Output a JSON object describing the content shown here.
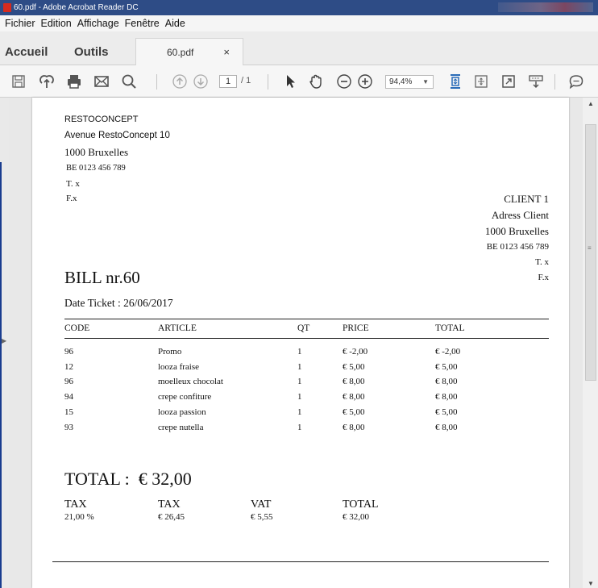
{
  "window": {
    "title": "60.pdf - Adobe Acrobat Reader DC"
  },
  "menu": [
    "Fichier",
    "Edition",
    "Affichage",
    "Fenêtre",
    "Aide"
  ],
  "tabs": {
    "home": "Accueil",
    "tools": "Outils",
    "doc": "60.pdf",
    "close": "×"
  },
  "toolbar": {
    "icons": [
      "save-icon",
      "upload-icon",
      "print-icon",
      "email-icon",
      "search-icon",
      "previous-page-icon",
      "next-page-icon",
      "select-tool-icon",
      "hand-tool-icon",
      "zoom-out-icon",
      "zoom-in-icon",
      "fit-page-icon",
      "full-screen-icon",
      "read-mode-icon",
      "keyboard-icon",
      "comment-icon"
    ],
    "page_current": "1",
    "page_total": "/ 1",
    "zoom": "94,4%"
  },
  "document": {
    "company": {
      "name": "RESTOCONCEPT",
      "address": "Avenue RestoConcept 10",
      "city": "1000 Bruxelles",
      "vat": "BE 0123 456 789",
      "tel": "T. x",
      "fax": "F.x"
    },
    "client": {
      "name": "CLIENT 1",
      "address": "Adress Client",
      "city": "1000 Bruxelles",
      "vat": "BE 0123 456 789",
      "tel": "T. x",
      "fax": "F.x"
    },
    "bill_title": "BILL nr.60",
    "date_line": "Date Ticket : 26/06/2017",
    "table": {
      "headers": [
        "CODE",
        "ARTICLE",
        "QT",
        "PRICE",
        "TOTAL"
      ],
      "rows": [
        [
          "96",
          "Promo",
          "1",
          "€ -2,00",
          "€ -2,00"
        ],
        [
          "12",
          "looza fraise",
          "1",
          "€ 5,00",
          "€ 5,00"
        ],
        [
          "96",
          "moelleux chocolat",
          "1",
          "€ 8,00",
          "€ 8,00"
        ],
        [
          "94",
          "crepe confiture",
          "1",
          "€ 8,00",
          "€ 8,00"
        ],
        [
          "15",
          "looza passion",
          "1",
          "€ 5,00",
          "€ 5,00"
        ],
        [
          "93",
          "crepe nutella",
          "1",
          "€ 8,00",
          "€ 8,00"
        ]
      ]
    },
    "total_line": "TOTAL :  € 32,00",
    "summary": {
      "headers": [
        "TAX",
        "TAX",
        "VAT",
        "TOTAL"
      ],
      "values": [
        "21,00 %",
        "€ 26,45",
        "€ 5,55",
        "€ 32,00"
      ]
    }
  }
}
